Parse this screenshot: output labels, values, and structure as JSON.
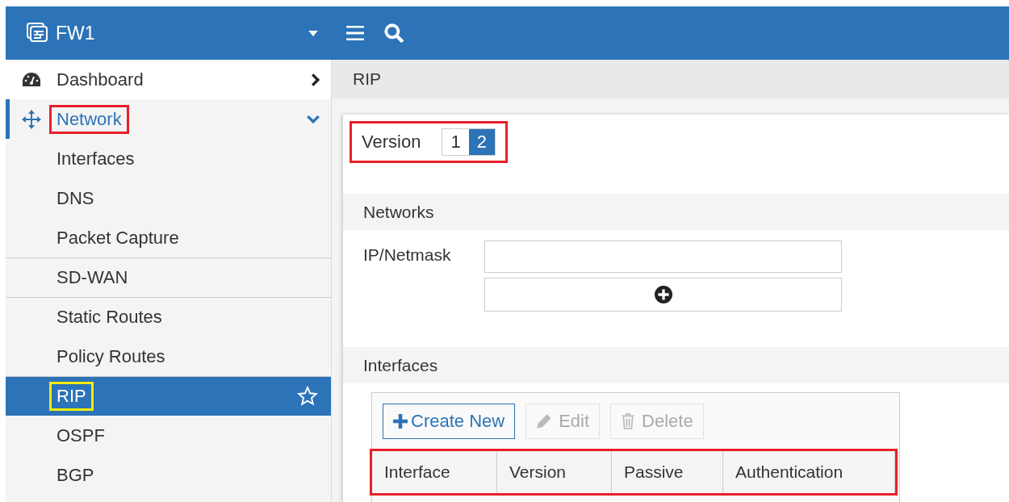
{
  "header": {
    "device": "FW1"
  },
  "sidebar": {
    "items": [
      {
        "label": "Dashboard",
        "expanded": false
      },
      {
        "label": "Network",
        "expanded": true,
        "color": "#e8202a",
        "children": [
          {
            "label": "Interfaces",
            "selected": false,
            "divider_before": false
          },
          {
            "label": "DNS",
            "selected": false,
            "divider_before": false
          },
          {
            "label": "Packet Capture",
            "selected": false,
            "divider_before": false
          },
          {
            "label": "SD-WAN",
            "selected": false,
            "divider_before": true
          },
          {
            "label": "Static Routes",
            "selected": false,
            "divider_before": true
          },
          {
            "label": "Policy Routes",
            "selected": false,
            "divider_before": false
          },
          {
            "label": "RIP",
            "selected": true,
            "divider_before": true,
            "color": "#f5ec00"
          },
          {
            "label": "OSPF",
            "selected": false,
            "divider_before": false
          },
          {
            "label": "BGP",
            "selected": false,
            "divider_before": false
          }
        ]
      }
    ]
  },
  "breadcrumb": "RIP",
  "version": {
    "label": "Version",
    "color": "#e8202a",
    "options": [
      {
        "label": "1",
        "selected": false
      },
      {
        "label": "2",
        "selected": true
      }
    ]
  },
  "networks": {
    "title": "Networks",
    "field_label": "IP/Netmask"
  },
  "interfaces": {
    "title": "Interfaces",
    "toolbar": [
      {
        "label": "Create New",
        "disabled": false
      },
      {
        "label": "Edit",
        "disabled": true
      },
      {
        "label": "Delete",
        "disabled": true
      }
    ],
    "table": {
      "color": "#e8202a",
      "columns": [
        "Interface",
        "Version",
        "Passive",
        "Authentication"
      ]
    }
  }
}
